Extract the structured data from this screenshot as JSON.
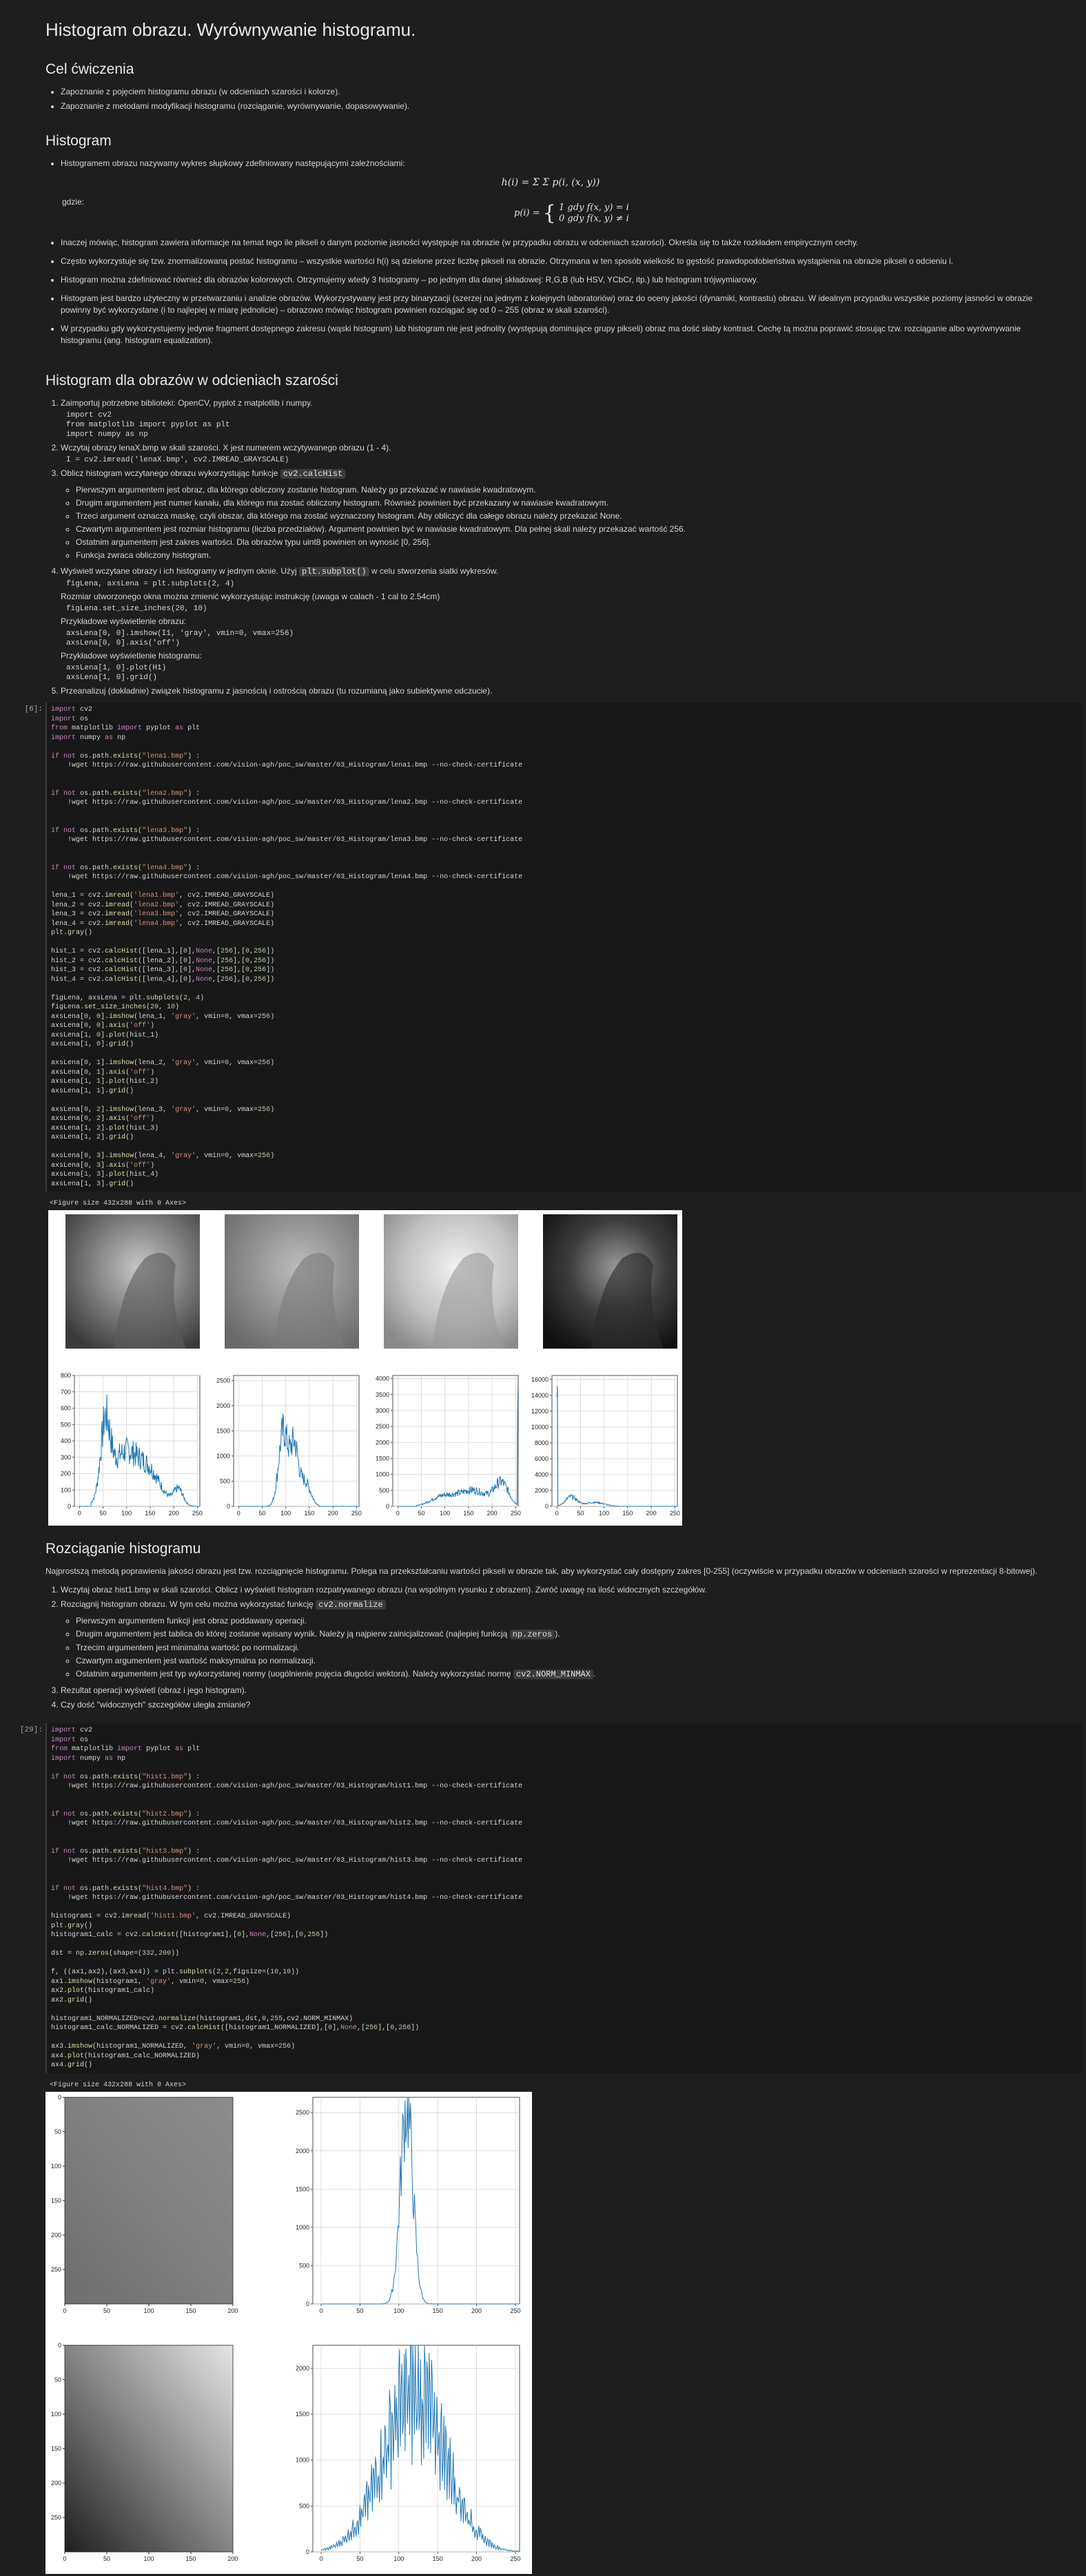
{
  "title": "Histogram obrazu. Wyrównywanie histogramu.",
  "section1": {
    "heading": "Cel ćwiczenia",
    "items": [
      "Zapoznanie z pojęciem histogramu obrazu (w odcieniach szarości i kolorze).",
      "Zapoznanie z metodami modyfikacji histogramu (rozciąganie, wyrównywanie, dopasowywanie)."
    ]
  },
  "section2": {
    "heading": "Histogram",
    "item1": "Histogramem obrazu nazywamy wykres słupkowy zdefiniowany następującymi zależnościami:",
    "formula1": "h(i) = Σ Σ p(i, (x, y))",
    "gdzie": "gdzie:",
    "formula2a": "1    gdy f(x, y) = i",
    "formula2b": "0    gdy f(x, y) ≠ i",
    "formula2_lhs": "p(i) =",
    "items": [
      "Inaczej mówiąc, histogram zawiera informacje na temat tego ile pikseli o danym poziomie jasności występuje na obrazie (w przypadku obrazu w odcieniach szarości). Określa się to także rozkładem empirycznym cechy.",
      "Często wykorzystuje się tzw. znormalizowaną postać histogramu – wszystkie wartości h(i) są dzielone przez liczbę pikseli na obrazie. Otrzymana w ten sposób wielkość to gęstość prawdopodobieństwa wystąpienia na obrazie pikseli o odcieniu i.",
      "Histogram można zdefiniować również dla obrazów kolorowych. Otrzymujemy wtedy 3 histogramy – po jednym dla danej składowej: R,G,B (lub HSV, YCbCr, itp.) lub histogram trójwymiarowy.",
      "Histogram jest bardzo użyteczny w przetwarzaniu i analizie obrazów. Wykorzystywany jest przy binaryzacji (szerzej na jednym z kolejnych laboratoriów) oraz do oceny jakości (dynamiki, kontrastu) obrazu. W idealnym przypadku wszystkie poziomy jasności w obrazie powinny być wykorzystane (i to najlepiej w miarę jednolicie) – obrazowo mówiąc histogram powinien rozciągać się od 0 – 255 (obraz w skali szarości).",
      "W przypadku gdy wykorzystujemy jedynie fragment dostępnego zakresu (wąski histogram) lub histogram nie jest jednolity (występują dominujące grupy pikseli) obraz ma dość słaby kontrast. Cechę tą można poprawić stosując tzw. rozciąganie albo wyrównywanie histogramu (ang. histogram equalization)."
    ]
  },
  "section3": {
    "heading": "Histogram dla obrazów w odcieniach szarości",
    "step1": "Zaimportuj potrzebne biblioteki: OpenCV, pyplot z matplotlib i numpy.",
    "code1": "import cv2\nfrom matplotlib import pyplot as plt\nimport numpy as np",
    "step2": "Wczytaj obrazy lenaX.bmp w skali szarości. X jest numerem wczytywanego obrazu (1 - 4).",
    "code2": "I = cv2.imread('lenaX.bmp', cv2.IMREAD_GRAYSCALE)",
    "step3": "Oblicz histogram wczytanego obrazu wykorzystując funkcje",
    "step3_code": "cv2.calcHist",
    "step3_items": [
      "Pierwszym argumentem jest obraz, dla którego obliczony zostanie histogram. Należy go przekazać w nawiasie kwadratowym.",
      "Drugim argumentem jest numer kanału, dla którego ma zostać obliczony histogram. Również powinien być przekazany w nawiasie kwadratowym.",
      "Trzeci argument oznacza maskę, czyli obszar, dla którego ma zostać wyznaczony histogram. Aby obliczyć dla całego obrazu należy przekazać None.",
      "Czwartym argumentem jest rozmiar histogramu (liczba przedziałów). Argument powinien być w nawiasie kwadratowym. Dla pełnej skali należy przekazać wartość 256.",
      "Ostatnim argumentem jest zakres wartości. Dla obrazów typu uint8 powinien on wynosić [0, 256].",
      "Funkcja zwraca obliczony histogram."
    ],
    "step4": "Wyświetl wczytane obrazy i ich histogramy w jednym oknie. Użyj",
    "step4_code": "plt.subplot()",
    "step4_tail": "w celu stworzenia siatki wykresów.",
    "code4a": "figLena, axsLena = plt.subplots(2, 4)",
    "step4_b": "Rozmiar utworzonego okna można zmienić wykorzystując instrukcję (uwaga w calach - 1 cal to 2.54cm)",
    "code4b": "figLena.set_size_inches(20, 10)",
    "step4_c": "Przykładowe wyświetlenie obrazu:",
    "code4c": "axsLena[0, 0].imshow(I1, 'gray', vmin=0, vmax=256)\naxsLena[0, 0].axis('off')",
    "step4_d": "Przykładowe wyświetlenie histogramu:",
    "code4d": "axsLena[1, 0].plot(H1)\naxsLena[1, 0].grid()",
    "step5": "Przeanalizuj (dokładnie) związek histogramu z jasnością i ostrością obrazu (tu rozumianą jako subiektywne odczucie)."
  },
  "cell1": {
    "prompt": "[6]:",
    "output_text": "<Figure size 432x288 with 0 Axes>"
  },
  "section4": {
    "heading": "Rozciąganie histogramu",
    "intro": "Najprostszą metodą poprawienia jakości obrazu jest tzw. rozciągnięcie histogramu. Polega na przekształcaniu wartości pikseli w obrazie tak, aby wykorzystać cały dostępny zakres [0-255] (oczywiście w przypadku obrazów w odcieniach szarości w reprezentacji 8-bitowej).",
    "step1": "Wczytaj obraz hist1.bmp w skali szarości. Oblicz i wyświetl histogram rozpatrywanego obrazu (na wspólnym rysunku z obrazem). Zwróć uwagę na ilość widocznych szczegółów.",
    "step2": "Rozciągnij histogram obrazu. W tym celu można wykorzystać funkcję",
    "step2_code": "cv2.normalize",
    "step2_items": [
      "Pierwszym argumentem funkcji jest obraz poddawany operacji.",
      "Drugim argumentem jest tablica do której zostanie wpisany wynik. Należy ją najpierw zainicjalizować (najlepiej funkcją",
      "Trzecim argumentem jest minimalna wartość po normalizacji.",
      "Czwartym argumentem jest wartość maksymalna po normalizacji.",
      "Ostatnim argumentem jest typ wykorzystanej normy (uogólnienie pojęcia długości wektora). Należy wykorzystać normę"
    ],
    "step2_item2_code": "np.zeros",
    "step2_item2_tail": ").",
    "step2_item5_code": "cv2.NORM_MINMAX",
    "step2_item5_tail": ".",
    "step3": "Rezultat operacji wyświetl (obraz i jego histogram).",
    "step4": "Czy dość \"widocznych\" szczegółów uległa zmianie?"
  },
  "cell2": {
    "prompt": "[29]:",
    "output_text": "<Figure size 432x288 with 0 Axes>"
  },
  "chart_data": [
    {
      "type": "line",
      "title": "",
      "x_ticks": [
        0,
        50,
        100,
        150,
        200,
        250
      ],
      "y_ticks": [
        0,
        100,
        200,
        300,
        400,
        500,
        600,
        700,
        800
      ],
      "ylim": [
        0,
        800
      ],
      "xlim": [
        0,
        256
      ]
    },
    {
      "type": "line",
      "title": "",
      "x_ticks": [
        0,
        50,
        100,
        150,
        200,
        250
      ],
      "y_ticks": [
        0,
        500,
        1000,
        1500,
        2000,
        2500
      ],
      "ylim": [
        0,
        2600
      ],
      "xlim": [
        0,
        256
      ]
    },
    {
      "type": "line",
      "title": "",
      "x_ticks": [
        0,
        50,
        100,
        150,
        200,
        250
      ],
      "y_ticks": [
        0,
        500,
        1000,
        1500,
        2000,
        2500,
        3000,
        3500,
        4000
      ],
      "ylim": [
        0,
        4100
      ],
      "xlim": [
        0,
        256
      ]
    },
    {
      "type": "line",
      "title": "",
      "x_ticks": [
        0,
        50,
        100,
        150,
        200,
        250
      ],
      "y_ticks": [
        0,
        2000,
        4000,
        6000,
        8000,
        10000,
        12000,
        14000,
        16000
      ],
      "ylim": [
        0,
        16500
      ],
      "xlim": [
        0,
        256
      ]
    },
    {
      "type": "line",
      "title": "",
      "x_ticks": [
        0,
        50,
        100,
        150,
        200,
        250
      ],
      "y_ticks": [
        0,
        500,
        1000,
        1500,
        2000,
        2500
      ],
      "ylim": [
        0,
        2700
      ],
      "xlim": [
        0,
        256
      ]
    },
    {
      "type": "line",
      "title": "",
      "x_ticks": [
        0,
        50,
        100,
        150,
        200,
        250
      ],
      "y_ticks": [
        0,
        500,
        1000,
        1500,
        2000
      ],
      "ylim": [
        0,
        2250
      ],
      "xlim": [
        0,
        256
      ]
    }
  ],
  "image_axes": {
    "x_ticks": [
      0,
      50,
      100,
      150,
      200,
      250
    ],
    "y_ticks": [
      0,
      50,
      100,
      150,
      200,
      250
    ]
  },
  "colors": {
    "line": "#1f77b4",
    "bg": "#1e1e1e"
  }
}
